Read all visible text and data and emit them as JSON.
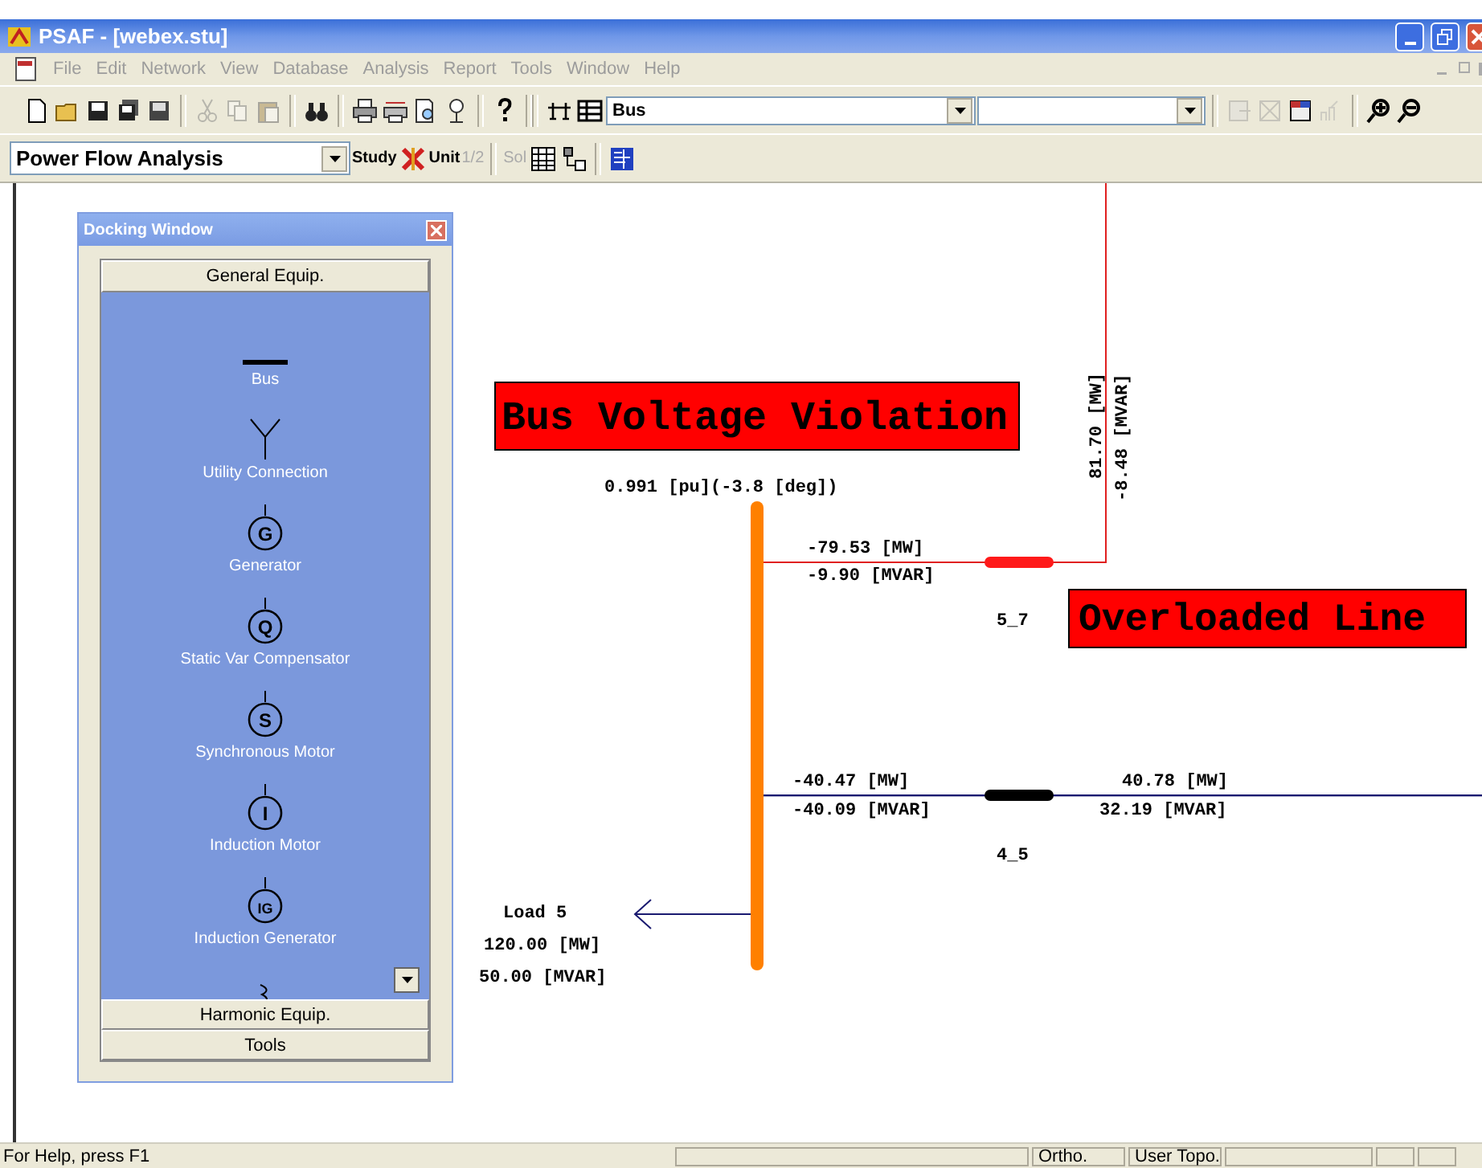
{
  "window": {
    "title": "PSAF - [webex.stu]"
  },
  "menu": [
    {
      "label": "File",
      "disabled": true
    },
    {
      "label": "Edit",
      "disabled": true
    },
    {
      "label": "Network",
      "disabled": true
    },
    {
      "label": "View",
      "disabled": true
    },
    {
      "label": "Database",
      "disabled": true
    },
    {
      "label": "Analysis",
      "disabled": true
    },
    {
      "label": "Report",
      "disabled": true
    },
    {
      "label": "Tools",
      "disabled": true
    },
    {
      "label": "Window",
      "disabled": true
    },
    {
      "label": "Help",
      "disabled": true
    }
  ],
  "toolbar": {
    "element_combo": {
      "value": "Bus"
    }
  },
  "analysis_bar": {
    "study_case": {
      "value": "Power Flow Analysis"
    },
    "labels": [
      {
        "text": "Study",
        "disabled": false
      },
      {
        "text": "Unit",
        "disabled": false
      },
      {
        "text": "1/2",
        "disabled": true
      },
      {
        "text": "Sol",
        "disabled": true
      }
    ]
  },
  "docking_window": {
    "title": "Docking Window",
    "sections": [
      {
        "label": "General Equip.",
        "expanded": true,
        "items": [
          {
            "kind": "bus",
            "label": "Bus"
          },
          {
            "kind": "utility",
            "label": "Utility Connection"
          },
          {
            "kind": "machine",
            "symbol": "G",
            "label": "Generator"
          },
          {
            "kind": "machine",
            "symbol": "Q",
            "label": "Static Var Compensator"
          },
          {
            "kind": "machine",
            "symbol": "S",
            "label": "Synchronous Motor"
          },
          {
            "kind": "machine",
            "symbol": "I",
            "label": "Induction Motor"
          },
          {
            "kind": "machine",
            "symbol": "IG",
            "label": "Induction Generator"
          },
          {
            "kind": "coil"
          }
        ]
      },
      {
        "label": "Harmonic Equip.",
        "expanded": false
      },
      {
        "label": "Tools",
        "expanded": false
      }
    ]
  },
  "diagram": {
    "bus": {
      "voltage": "0.991 [pu](-3.8 [deg])",
      "alarm": "Bus Voltage Violation"
    },
    "lines": [
      {
        "name": "5_7",
        "overloaded": true,
        "from_mw": "-79.53 [MW]",
        "from_mvar": "-9.90 [MVAR]",
        "to_mw": "81.70 [MW]",
        "to_mvar": "-8.48 [MVAR]",
        "alarm": "Overloaded Line"
      },
      {
        "name": "4_5",
        "overloaded": false,
        "from_mw": "-40.47 [MW]",
        "from_mvar": "-40.09 [MVAR]",
        "to_mw": "40.78 [MW]",
        "to_mvar": "32.19 [MVAR]"
      }
    ],
    "load": {
      "name": "Load 5",
      "mw": "120.00 [MW]",
      "mvar": "50.00 [MVAR]"
    }
  },
  "status_bar": {
    "help": "For Help, press F1",
    "panes": [
      {
        "text": "Ortho."
      },
      {
        "text": "User Topo."
      }
    ]
  }
}
